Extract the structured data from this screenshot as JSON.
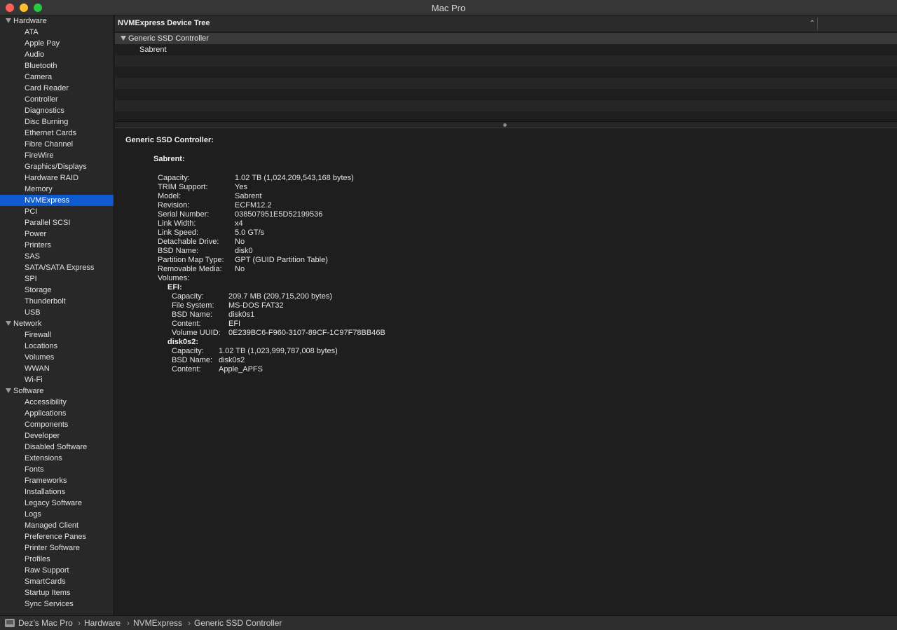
{
  "window": {
    "title": "Mac Pro"
  },
  "sidebar": {
    "groups": [
      {
        "label": "Hardware",
        "items": [
          "ATA",
          "Apple Pay",
          "Audio",
          "Bluetooth",
          "Camera",
          "Card Reader",
          "Controller",
          "Diagnostics",
          "Disc Burning",
          "Ethernet Cards",
          "Fibre Channel",
          "FireWire",
          "Graphics/Displays",
          "Hardware RAID",
          "Memory",
          "NVMExpress",
          "PCI",
          "Parallel SCSI",
          "Power",
          "Printers",
          "SAS",
          "SATA/SATA Express",
          "SPI",
          "Storage",
          "Thunderbolt",
          "USB"
        ]
      },
      {
        "label": "Network",
        "items": [
          "Firewall",
          "Locations",
          "Volumes",
          "WWAN",
          "Wi-Fi"
        ]
      },
      {
        "label": "Software",
        "items": [
          "Accessibility",
          "Applications",
          "Components",
          "Developer",
          "Disabled Software",
          "Extensions",
          "Fonts",
          "Frameworks",
          "Installations",
          "Legacy Software",
          "Logs",
          "Managed Client",
          "Preference Panes",
          "Printer Software",
          "Profiles",
          "Raw Support",
          "SmartCards",
          "Startup Items",
          "Sync Services"
        ]
      }
    ],
    "selected": "NVMExpress"
  },
  "tree": {
    "header": "NVMExpress Device Tree",
    "controller": "Generic SSD Controller",
    "device": "Sabrent"
  },
  "detail": {
    "title": "Generic SSD Controller:",
    "device_title": "Sabrent:",
    "properties": [
      {
        "key": "Capacity:",
        "value": "1.02 TB (1,024,209,543,168 bytes)"
      },
      {
        "key": "TRIM Support:",
        "value": "Yes"
      },
      {
        "key": "Model:",
        "value": "Sabrent"
      },
      {
        "key": "Revision:",
        "value": "ECFM12.2"
      },
      {
        "key": "Serial Number:",
        "value": "038507951E5D52199536"
      },
      {
        "key": "Link Width:",
        "value": "x4"
      },
      {
        "key": "Link Speed:",
        "value": "5.0 GT/s"
      },
      {
        "key": "Detachable Drive:",
        "value": "No"
      },
      {
        "key": "BSD Name:",
        "value": "disk0"
      },
      {
        "key": "Partition Map Type:",
        "value": "GPT (GUID Partition Table)"
      },
      {
        "key": "Removable Media:",
        "value": "No"
      },
      {
        "key": "Volumes:",
        "value": ""
      }
    ],
    "volumes": [
      {
        "name": "EFI:",
        "properties": [
          {
            "key": "Capacity:",
            "value": "209.7 MB (209,715,200 bytes)"
          },
          {
            "key": "File System:",
            "value": "MS-DOS FAT32"
          },
          {
            "key": "BSD Name:",
            "value": "disk0s1"
          },
          {
            "key": "Content:",
            "value": "EFI"
          },
          {
            "key": "Volume UUID:",
            "value": "0E239BC6-F960-3107-89CF-1C97F78BB46B"
          }
        ]
      },
      {
        "name": "disk0s2:",
        "properties": [
          {
            "key": "Capacity:",
            "value": "1.02 TB (1,023,999,787,008 bytes)"
          },
          {
            "key": "BSD Name:",
            "value": "disk0s2"
          },
          {
            "key": "Content:",
            "value": "Apple_APFS"
          }
        ]
      }
    ]
  },
  "pathbar": {
    "crumbs": [
      "Dez’s Mac Pro",
      "Hardware",
      "NVMExpress",
      "Generic SSD Controller"
    ],
    "separator": "›"
  },
  "icons": {
    "sort": "chevron-up-icon",
    "computer": "mac-pro-icon"
  }
}
